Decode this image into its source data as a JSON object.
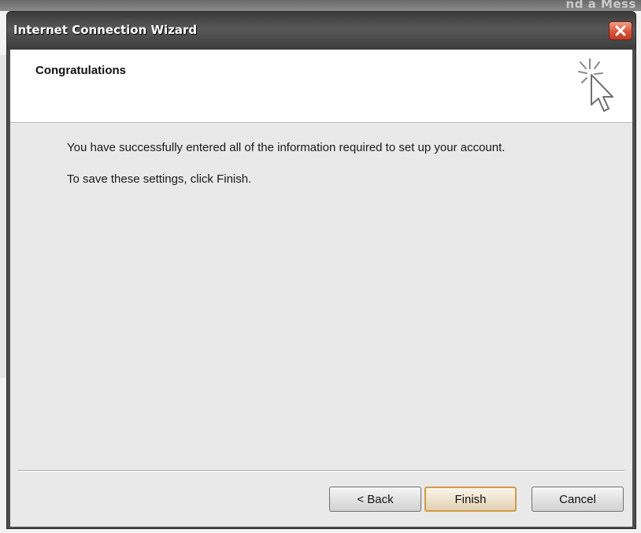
{
  "background": {
    "partial_text": "nd a Mess"
  },
  "window": {
    "title": "Internet Connection Wizard",
    "close_icon": "close-x-icon",
    "close_color": "#d9533b"
  },
  "header": {
    "title": "Congratulations",
    "icon": "wizard-sparkle-cursor-icon"
  },
  "body": {
    "line1": "You have successfully entered all of the information required to set up your account.",
    "line2": "To save these settings, click Finish."
  },
  "buttons": {
    "back_label": "< Back",
    "finish_label": "Finish",
    "cancel_label": "Cancel",
    "default_button": "Finish",
    "default_border_color": "#d29a44"
  }
}
